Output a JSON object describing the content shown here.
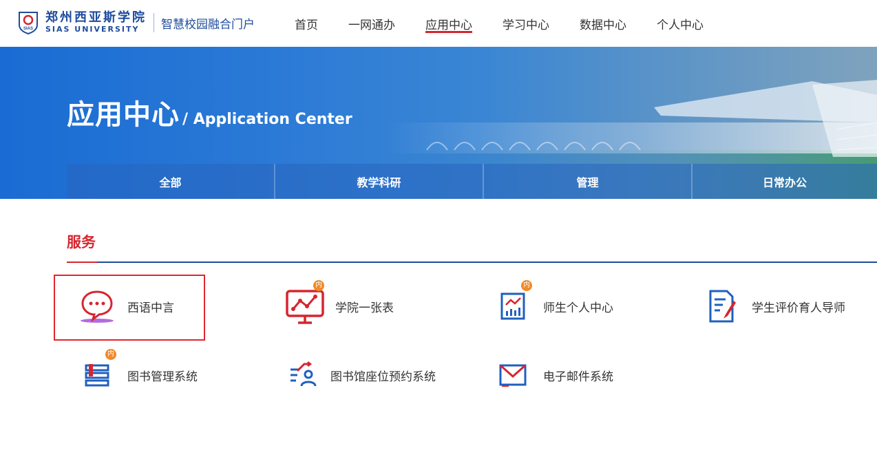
{
  "header": {
    "logo_cn": "郑州西亚斯学院",
    "logo_en": "SIAS UNIVERSITY",
    "logo_badge": "SIAS",
    "portal_name": "智慧校园融合门户",
    "nav": [
      "首页",
      "一网通办",
      "应用中心",
      "学习中心",
      "数据中心",
      "个人中心"
    ],
    "active_nav": "应用中心"
  },
  "banner": {
    "title_cn": "应用中心",
    "title_en": "/ Application Center",
    "tabs": [
      "全部",
      "教学科研",
      "管理",
      "日常办公"
    ]
  },
  "section": {
    "title": "服务"
  },
  "apps": [
    {
      "label": "西语中言",
      "icon": "chat-bubble-icon",
      "badge": ""
    },
    {
      "label": "学院一张表",
      "icon": "chart-monitor-icon",
      "badge": "内"
    },
    {
      "label": "师生个人中心",
      "icon": "report-chart-icon",
      "badge": "内"
    },
    {
      "label": "学生评价育人导师",
      "icon": "document-edit-icon",
      "badge": ""
    },
    {
      "label": "图书管理系统",
      "icon": "book-stack-icon",
      "badge": "内"
    },
    {
      "label": "图书馆座位预约系统",
      "icon": "seat-booking-icon",
      "badge": ""
    },
    {
      "label": "电子邮件系统",
      "icon": "mail-icon",
      "badge": ""
    }
  ],
  "colors": {
    "accent_red": "#d6252f",
    "brand_blue": "#1d4b9c",
    "badge_orange": "#f08a2a"
  }
}
